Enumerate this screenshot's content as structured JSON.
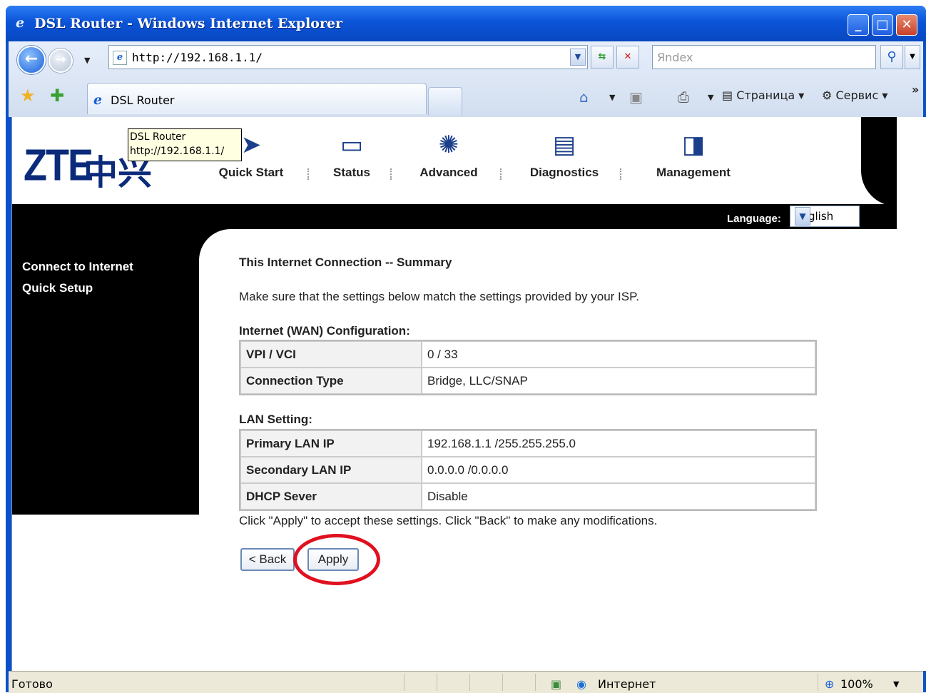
{
  "window": {
    "title": "DSL Router - Windows Internet Explorer",
    "buttons": [
      "_",
      "□",
      "✕"
    ]
  },
  "browser": {
    "url": "http://192.168.1.1/",
    "search_placeholder": "Яndex",
    "tab_label": "DSL Router",
    "page_menu": "Страница",
    "tools_menu": "Сервис",
    "chevron": "»"
  },
  "tooltip": {
    "title": "DSL Router",
    "url": "http://192.168.1.1/"
  },
  "router": {
    "logo": "ZTE",
    "logo_cn": "中兴",
    "nav": [
      "Quick Start",
      "Status",
      "Advanced",
      "Diagnostics",
      "Management"
    ],
    "language_label": "Language:",
    "language_value": "English",
    "sidebar": [
      "Connect to Internet",
      "Quick Setup"
    ]
  },
  "summary": {
    "title": "This Internet Connection -- Summary",
    "description": "Make sure that the settings below match the settings provided by your ISP.",
    "wan_title": "Internet (WAN) Configuration:",
    "wan_rows": [
      {
        "key": "VPI / VCI",
        "value": "0 / 33"
      },
      {
        "key": "Connection Type",
        "value": "Bridge, LLC/SNAP"
      }
    ],
    "lan_title": "LAN Setting:",
    "lan_rows": [
      {
        "key": "Primary LAN IP",
        "value": "192.168.1.1 /255.255.255.0"
      },
      {
        "key": "Secondary LAN IP",
        "value": "0.0.0.0 /0.0.0.0"
      },
      {
        "key": "DHCP Sever",
        "value": "Disable"
      }
    ],
    "note": "Click \"Apply\" to accept these settings. Click \"Back\" to make any modifications.",
    "back_label": "< Back",
    "apply_label": "Apply"
  },
  "status": {
    "text": "Готово",
    "zone": "Интернет",
    "zoom": "100%"
  },
  "colors": {
    "highlight": "#e01020",
    "titlebar": "#0b54d8"
  }
}
